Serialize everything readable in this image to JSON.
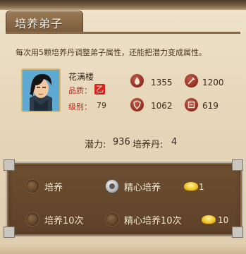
{
  "header": {
    "title": "培养弟子"
  },
  "intro": "每次用5颗培养丹调整弟子属性，还能把潜力变成属性。",
  "disciple": {
    "name": "花满楼",
    "quality_label": "品质：",
    "quality_badge": "乙",
    "level_label": "级别：",
    "level": "79"
  },
  "stats": {
    "hp": "1355",
    "attack": "1200",
    "defense": "1062",
    "internal": "619",
    "icons": [
      "blood-icon",
      "attack-icon",
      "defense-icon",
      "internal-icon"
    ]
  },
  "summary": {
    "potential_label": "潜力:",
    "potential": "936",
    "pill_label": "培养丹:",
    "pill": "4"
  },
  "options": [
    {
      "label": "培养",
      "selected": false,
      "cost": ""
    },
    {
      "label": "精心培养",
      "selected": true,
      "cost": "1"
    },
    {
      "label": "培养10次",
      "selected": false,
      "cost": ""
    },
    {
      "label": "精心培养10次",
      "selected": false,
      "cost": "10"
    }
  ],
  "colors": {
    "accent": "#c0281d",
    "panel": "#6d4e31",
    "gold": "#f2c62b"
  }
}
